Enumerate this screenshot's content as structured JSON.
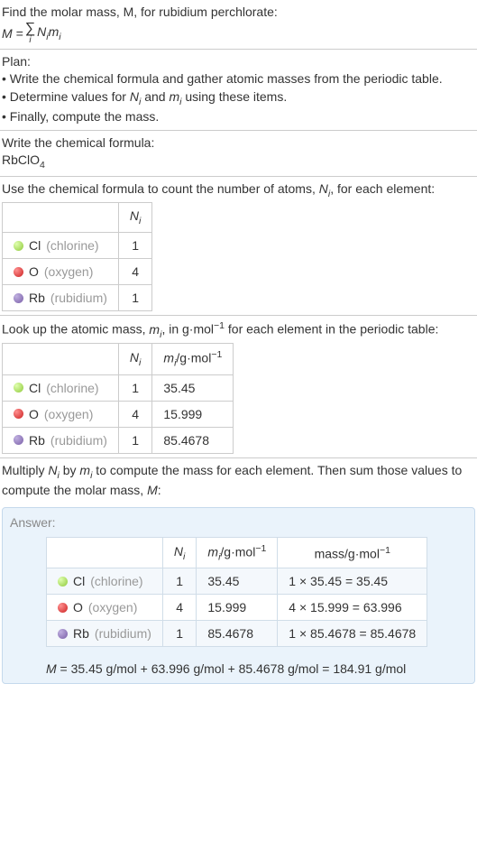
{
  "intro": {
    "line1": "Find the molar mass, M, for rubidium perchlorate:",
    "formula_left": "M = ",
    "formula_sigma_idx": "i",
    "formula_right_n": "N",
    "formula_right_n_sub": "i",
    "formula_right_m": "m",
    "formula_right_m_sub": "i"
  },
  "plan": {
    "header": "Plan:",
    "bullet1": "• Write the chemical formula and gather atomic masses from the periodic table.",
    "bullet2_a": "• Determine values for ",
    "bullet2_n": "N",
    "bullet2_n_sub": "i",
    "bullet2_and": " and ",
    "bullet2_m": "m",
    "bullet2_m_sub": "i",
    "bullet2_b": " using these items.",
    "bullet3": "• Finally, compute the mass."
  },
  "chemFormula": {
    "header": "Write the chemical formula:",
    "formula": "RbClO",
    "formula_sub": "4"
  },
  "countAtoms": {
    "header_a": "Use the chemical formula to count the number of atoms, ",
    "header_n": "N",
    "header_n_sub": "i",
    "header_b": ", for each element:",
    "col_n": "N",
    "col_n_sub": "i",
    "rows": [
      {
        "dot": "dot-cl",
        "symbol": "Cl",
        "name": "(chlorine)",
        "n": "1"
      },
      {
        "dot": "dot-o",
        "symbol": "O",
        "name": "(oxygen)",
        "n": "4"
      },
      {
        "dot": "dot-rb",
        "symbol": "Rb",
        "name": "(rubidium)",
        "n": "1"
      }
    ]
  },
  "atomicMass": {
    "header_a": "Look up the atomic mass, ",
    "header_m": "m",
    "header_m_sub": "i",
    "header_b": ", in g·mol",
    "header_sup": "−1",
    "header_c": " for each element in the periodic table:",
    "col_n": "N",
    "col_n_sub": "i",
    "col_m": "m",
    "col_m_sub": "i",
    "col_m_unit": "/g·mol",
    "col_m_sup": "−1",
    "rows": [
      {
        "dot": "dot-cl",
        "symbol": "Cl",
        "name": "(chlorine)",
        "n": "1",
        "m": "35.45"
      },
      {
        "dot": "dot-o",
        "symbol": "O",
        "name": "(oxygen)",
        "n": "4",
        "m": "15.999"
      },
      {
        "dot": "dot-rb",
        "symbol": "Rb",
        "name": "(rubidium)",
        "n": "1",
        "m": "85.4678"
      }
    ]
  },
  "multiply": {
    "header_a": "Multiply ",
    "header_n": "N",
    "header_n_sub": "i",
    "header_by": " by ",
    "header_m": "m",
    "header_m_sub": "i",
    "header_b": " to compute the mass for each element. Then sum those values to compute the molar mass, ",
    "header_M": "M",
    "header_c": ":"
  },
  "answer": {
    "label": "Answer:",
    "col_n": "N",
    "col_n_sub": "i",
    "col_m": "m",
    "col_m_sub": "i",
    "col_m_unit": "/g·mol",
    "col_m_sup": "−1",
    "col_mass": "mass/g·mol",
    "col_mass_sup": "−1",
    "rows": [
      {
        "dot": "dot-cl",
        "symbol": "Cl",
        "name": "(chlorine)",
        "n": "1",
        "m": "35.45",
        "mass": "1 × 35.45 = 35.45"
      },
      {
        "dot": "dot-o",
        "symbol": "O",
        "name": "(oxygen)",
        "n": "4",
        "m": "15.999",
        "mass": "4 × 15.999 = 63.996"
      },
      {
        "dot": "dot-rb",
        "symbol": "Rb",
        "name": "(rubidium)",
        "n": "1",
        "m": "85.4678",
        "mass": "1 × 85.4678 = 85.4678"
      }
    ],
    "final_m": "M",
    "final_eq": " = 35.45 g/mol + 63.996 g/mol + 85.4678 g/mol = 184.91 g/mol"
  }
}
